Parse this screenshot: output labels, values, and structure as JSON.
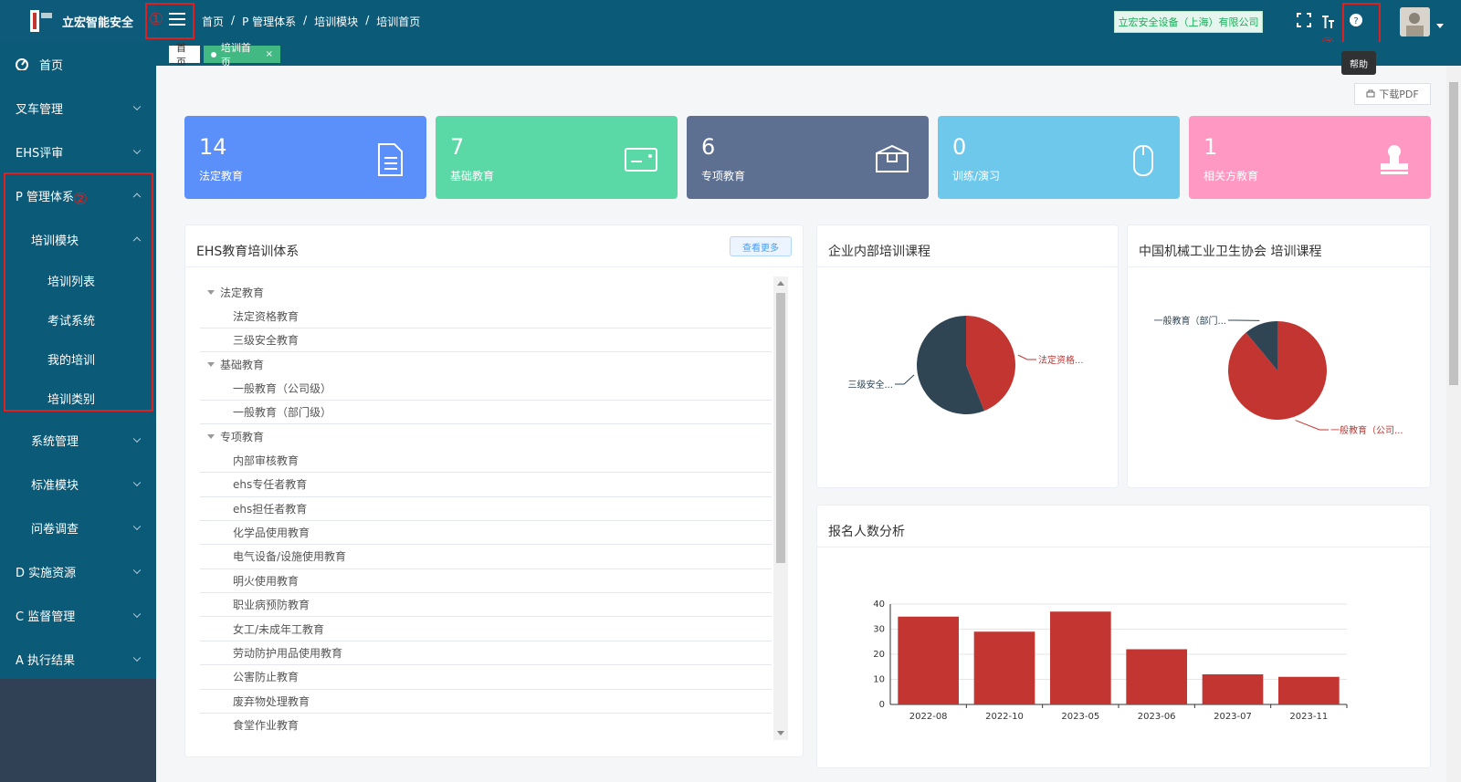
{
  "app": {
    "name": "立宏智能安全"
  },
  "header": {
    "breadcrumb": [
      "首页",
      "/",
      "P 管理体系",
      "/",
      "培训模块",
      "/",
      "培训首页"
    ],
    "company": "立宏安全设备（上海）有限公司",
    "help_tooltip": "帮助"
  },
  "annotations": {
    "n1": "①",
    "n2": "②",
    "n3": "③"
  },
  "tabs": {
    "home": "首页",
    "active": "培训首页",
    "close": "×"
  },
  "sidebar": {
    "items": [
      {
        "label": "首页"
      },
      {
        "label": "叉车管理"
      },
      {
        "label": "EHS评审"
      },
      {
        "label": "P 管理体系"
      },
      {
        "label": "培训模块"
      },
      {
        "label": "培训列表"
      },
      {
        "label": "考试系统"
      },
      {
        "label": "我的培训"
      },
      {
        "label": "培训类别"
      },
      {
        "label": "系统管理"
      },
      {
        "label": "标准模块"
      },
      {
        "label": "问卷调查"
      },
      {
        "label": "D 实施资源"
      },
      {
        "label": "C 监督管理"
      },
      {
        "label": "A 执行结果"
      }
    ]
  },
  "toolbar": {
    "download_pdf": "下载PDF"
  },
  "stats": [
    {
      "value": "14",
      "label": "法定教育",
      "color": "#5b8ff9"
    },
    {
      "value": "7",
      "label": "基础教育",
      "color": "#5ad8a6"
    },
    {
      "value": "6",
      "label": "专项教育",
      "color": "#5d7092"
    },
    {
      "value": "0",
      "label": "训练/演习",
      "color": "#6dc8ec"
    },
    {
      "value": "1",
      "label": "相关方教育",
      "color": "#ff99c3"
    }
  ],
  "ehs_panel": {
    "title": "EHS教育培训体系",
    "more": "查看更多",
    "tree": [
      {
        "label": "法定教育",
        "type": "parent"
      },
      {
        "label": "法定资格教育",
        "type": "child"
      },
      {
        "label": "三级安全教育",
        "type": "child"
      },
      {
        "label": "基础教育",
        "type": "parent"
      },
      {
        "label": "一般教育（公司级）",
        "type": "child"
      },
      {
        "label": "一般教育（部门级）",
        "type": "child"
      },
      {
        "label": "专项教育",
        "type": "parent"
      },
      {
        "label": "内部审核教育",
        "type": "child"
      },
      {
        "label": "ehs专任者教育",
        "type": "child"
      },
      {
        "label": "ehs担任者教育",
        "type": "child"
      },
      {
        "label": "化学品使用教育",
        "type": "child"
      },
      {
        "label": "电气设备/设施使用教育",
        "type": "child"
      },
      {
        "label": "明火使用教育",
        "type": "child"
      },
      {
        "label": "职业病预防教育",
        "type": "child"
      },
      {
        "label": "女工/未成年工教育",
        "type": "child"
      },
      {
        "label": "劳动防护用品使用教育",
        "type": "child"
      },
      {
        "label": "公害防止教育",
        "type": "child"
      },
      {
        "label": "废弃物处理教育",
        "type": "child"
      },
      {
        "label": "食堂作业教育",
        "type": "child"
      }
    ]
  },
  "pie1": {
    "title": "企业内部培训课程",
    "slices": [
      {
        "label": "法定资格...",
        "value": 44,
        "color": "#c23531"
      },
      {
        "label": "三级安全...",
        "value": 56,
        "color": "#2f4554"
      }
    ]
  },
  "pie2": {
    "title": "中国机械工业卫生协会 培训课程",
    "slices": [
      {
        "label": "一般教育（公司...",
        "value": 89,
        "color": "#c23531"
      },
      {
        "label": "一般教育（部门...",
        "value": 11,
        "color": "#2f4554"
      }
    ]
  },
  "bar_panel": {
    "title": "报名人数分析"
  },
  "chart_data": {
    "type": "bar",
    "title": "报名人数分析",
    "categories": [
      "2022-08",
      "2022-10",
      "2023-05",
      "2023-06",
      "2023-07",
      "2023-11"
    ],
    "values": [
      35,
      29,
      37,
      22,
      12,
      11
    ],
    "ylim": [
      0,
      40
    ],
    "yticks": [
      "0",
      "10",
      "20",
      "30",
      "40"
    ],
    "color": "#c23531",
    "grid": true
  }
}
